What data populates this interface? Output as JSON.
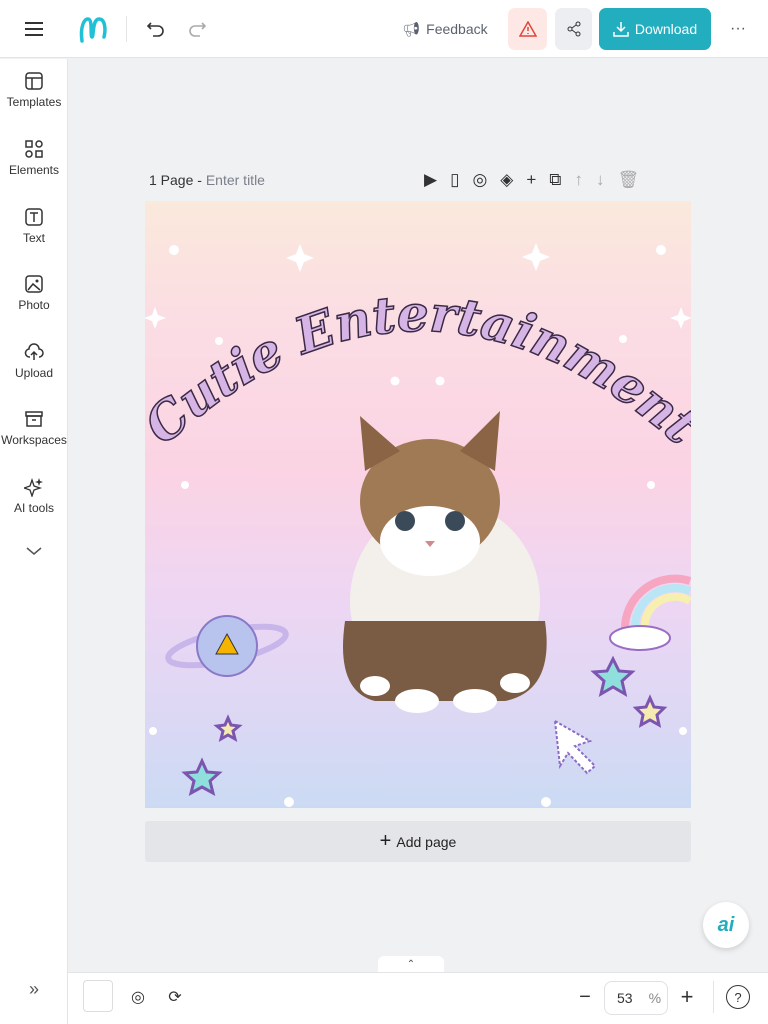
{
  "topbar": {
    "feedback_label": "Feedback",
    "download_label": "Download",
    "accent": "#22aebf"
  },
  "sidebar": {
    "items": [
      {
        "label": "Templates"
      },
      {
        "label": "Elements"
      },
      {
        "label": "Text"
      },
      {
        "label": "Photo"
      },
      {
        "label": "Upload"
      },
      {
        "label": "Workspaces"
      },
      {
        "label": "AI tools"
      }
    ]
  },
  "page": {
    "count_label": "1 Page -",
    "title_placeholder": "Enter title"
  },
  "design": {
    "title": "Cutie Entertainment"
  },
  "add_page_label": "Add page",
  "ai_button_label": "ai",
  "bottombar": {
    "zoom_value": "53",
    "zoom_unit": "%"
  }
}
